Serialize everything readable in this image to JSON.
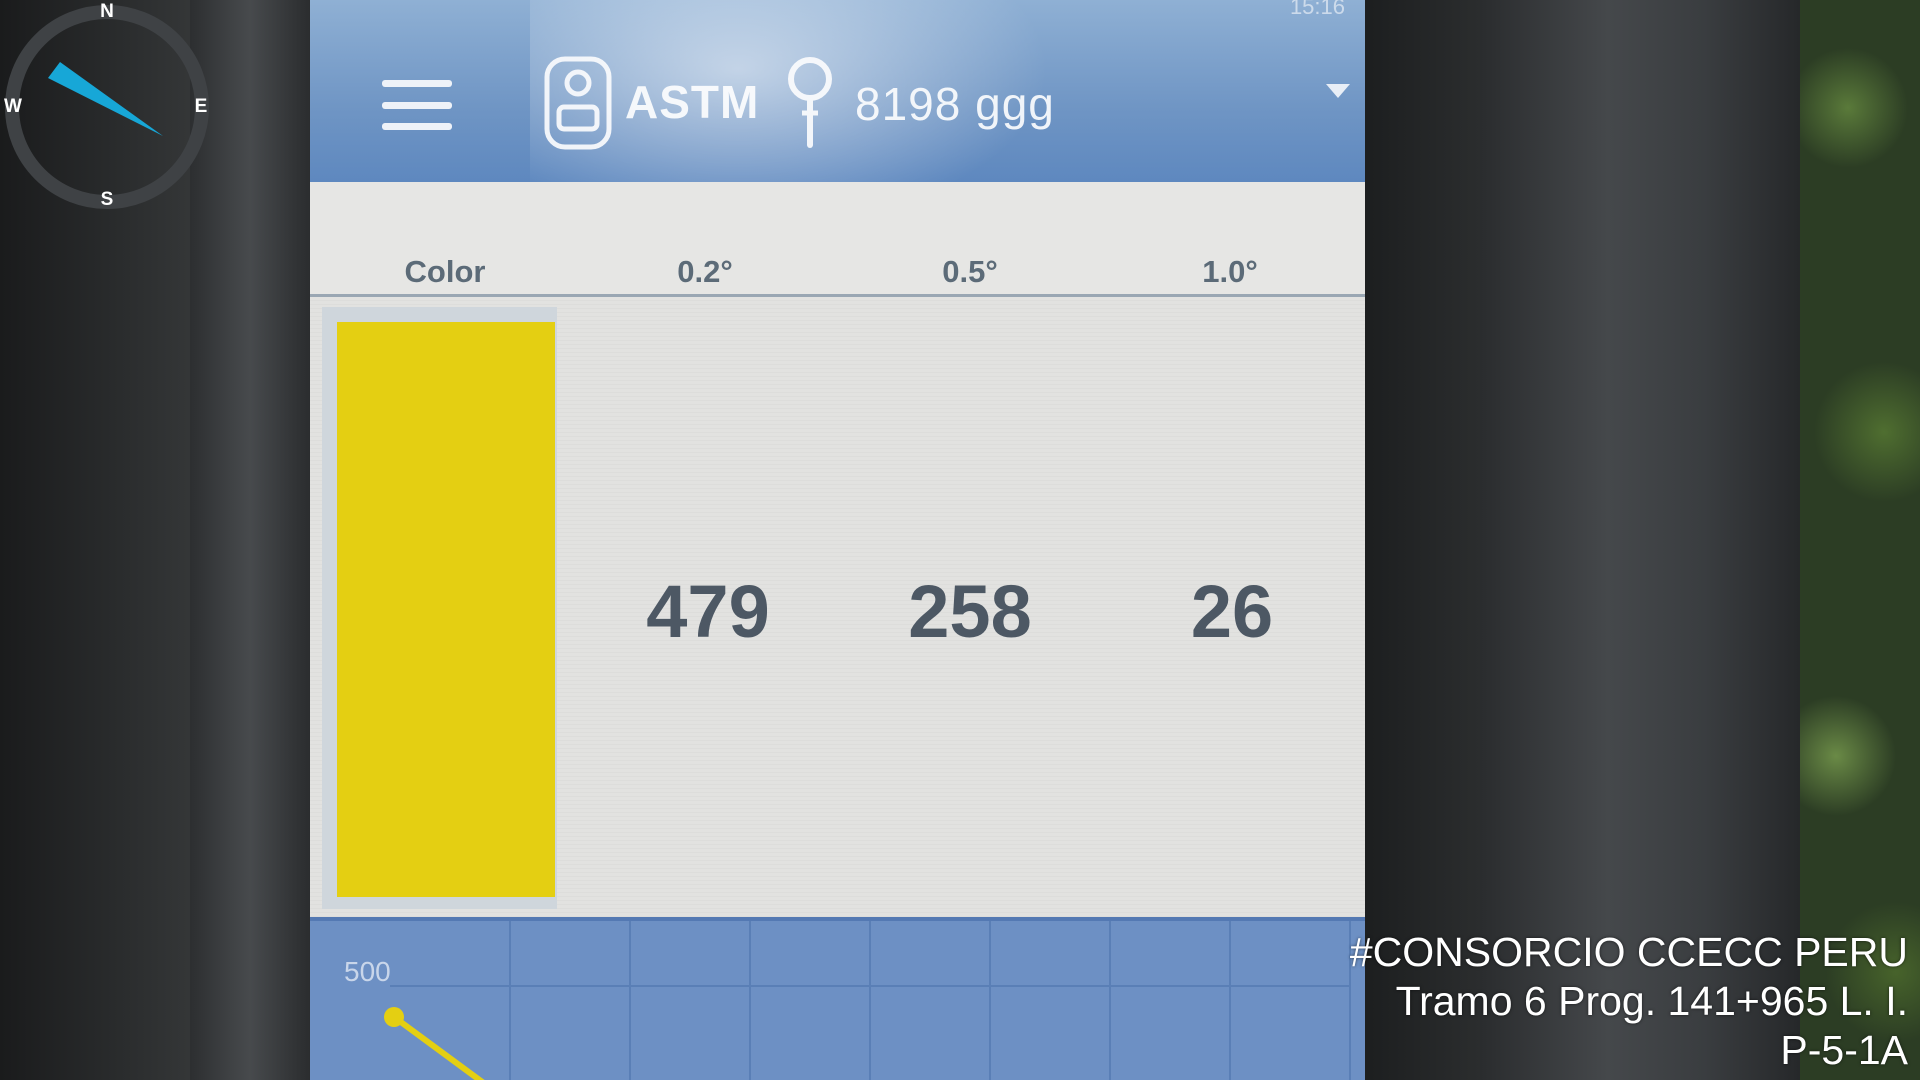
{
  "compass": {
    "north": "N",
    "south": "S",
    "east": "E",
    "west": "W",
    "needle_color": "#17a7d7"
  },
  "app_bar": {
    "status_time": "15:16",
    "menu_icon": "hamburger-menu-icon",
    "device_icon": "retroreflectometer-icon",
    "standard": "ASTM",
    "geometry_icon": "measurement-probe-icon",
    "geometry": "8198 ggg",
    "dropdown_icon": "dropdown-arrow-icon",
    "bar_color": "#6f95c4"
  },
  "table": {
    "headers": [
      "Color",
      "0.2°",
      "0.5°",
      "1.0°"
    ],
    "row": {
      "swatch_color": "#e4cf12",
      "values": [
        "479",
        "258",
        "26"
      ]
    }
  },
  "graph": {
    "y_max_label": "500",
    "background_color": "#6d90c4",
    "line_color": "#e4cf12"
  },
  "caption": {
    "line1": "#CONSORCIO CCECC PERU",
    "line2": "Tramo 6 Prog. 141+965 L. I.",
    "line3": "P-5-1A"
  }
}
